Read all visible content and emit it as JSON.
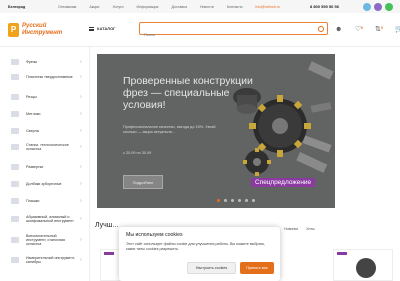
{
  "topbar": {
    "city": "Белгород",
    "menu": [
      "Оптовикам",
      "Акции",
      "Услуги",
      "Информация",
      "Доставка",
      "Новости",
      "Контакты"
    ],
    "email": "info@belinstr.ru",
    "phone": "8 800 550 56 56"
  },
  "header": {
    "logo_mark": "Р",
    "logo_line1": "Русский",
    "logo_line2": "Инструмент",
    "catalog_label": "КАТАЛОГ",
    "search_placeholder": "Поиск",
    "favorites_count": "0",
    "compare_count": "0",
    "cart_count": "0"
  },
  "sidebar": {
    "items": [
      {
        "label": "Фрезы"
      },
      {
        "label": "Пластины твердосплавные"
      },
      {
        "label": "Резцы"
      },
      {
        "label": "Метчики"
      },
      {
        "label": "Сверла"
      },
      {
        "label": "Станки, технологическое оснастка"
      },
      {
        "label": "Развертки"
      },
      {
        "label": "Долбяки зуборезные"
      },
      {
        "label": "Плашки"
      },
      {
        "label": "Абразивный, алмазный и шлифовальный инструмент"
      },
      {
        "label": "Вспомогательный инструмент, станочная оснастка"
      },
      {
        "label": "Измерительный инструмент, калибры"
      }
    ]
  },
  "banner": {
    "title": "Проверенные конструкции фрез — специальные условия!",
    "subtitle": "Профессиональное качество, выгода до 15%. Узнай сколько — акция актуальна...",
    "date": "с 20.09 по 30.09",
    "button_label": "Подробнее",
    "tag": "Спецпредложение",
    "slide_count": 6,
    "active_slide": 1
  },
  "section": {
    "title": "Лучш...",
    "tabs": [
      "Новинки",
      "Хиты"
    ]
  },
  "cookie": {
    "title": "Мы используем cookies",
    "text": "Этот сайт использует файлы cookie для улучшения работы. Вы можете выбрать, какие типы cookies разрешить.",
    "settings_label": "Настроить cookies",
    "accept_label": "Принять все"
  },
  "colors": {
    "accent": "#e46f1a",
    "banner_bg": "#626363",
    "tag_bg": "#8a3aa0"
  }
}
